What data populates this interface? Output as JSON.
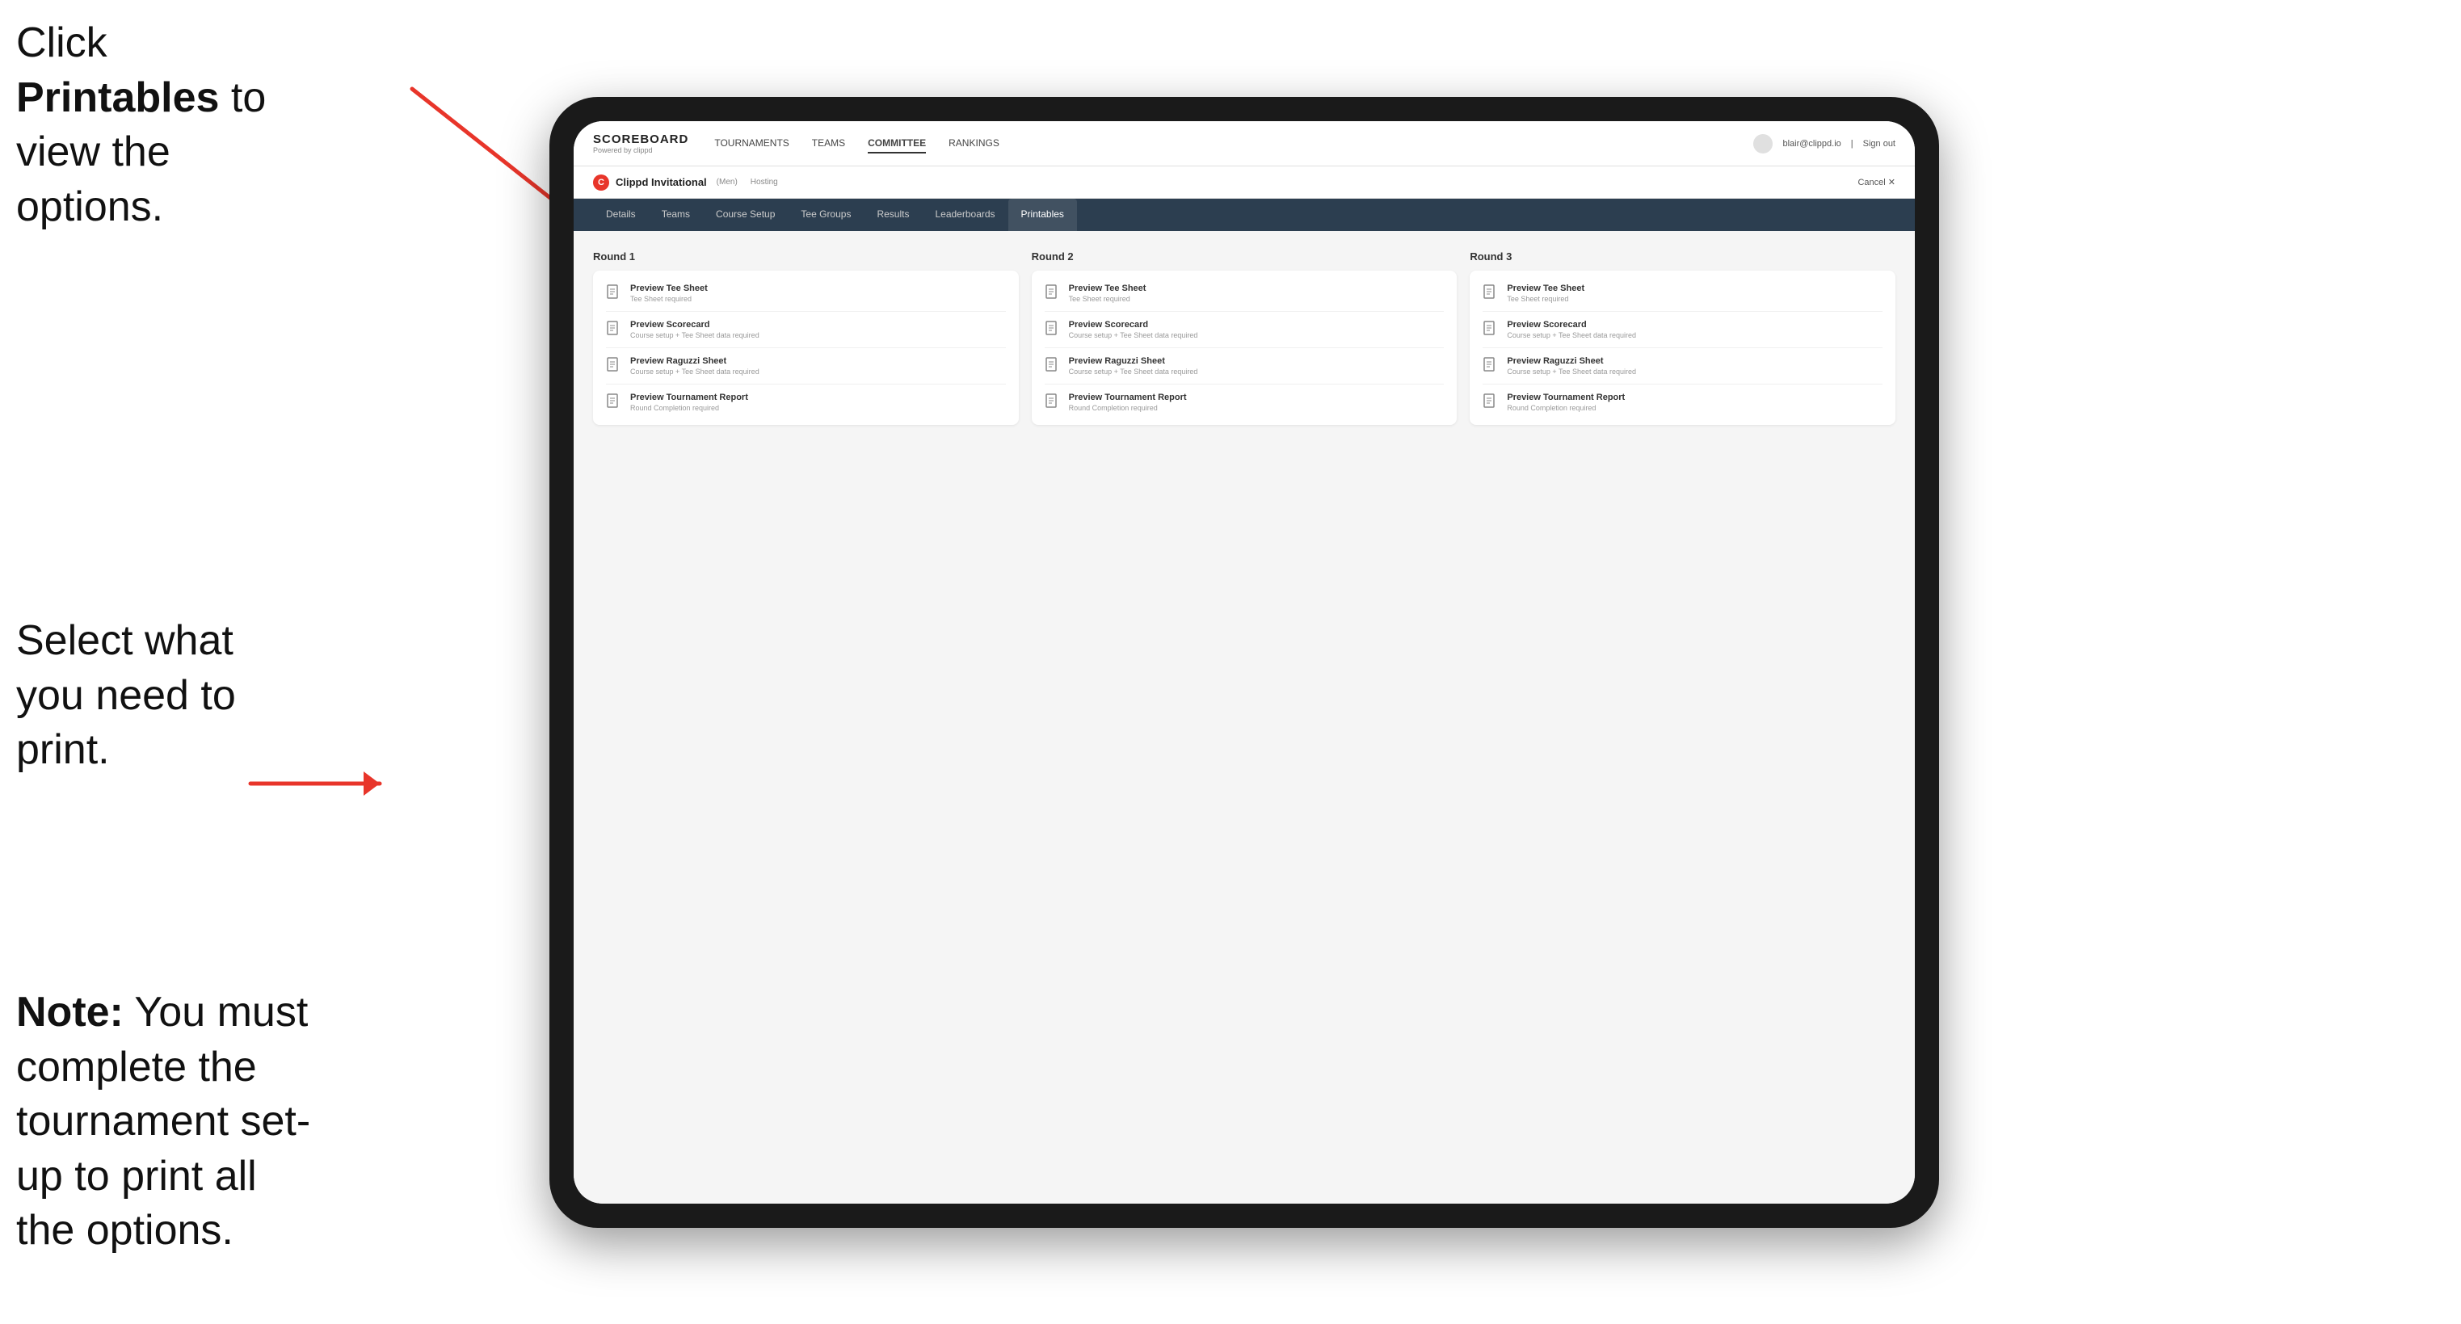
{
  "annotations": {
    "top": {
      "before": "Click ",
      "bold": "Printables",
      "after": " to view the options."
    },
    "middle": {
      "text": "Select what you need to print."
    },
    "bottom": {
      "bold_prefix": "Note:",
      "text": " You must complete the tournament set-up to print all the options."
    }
  },
  "top_nav": {
    "brand": "SCOREBOARD",
    "brand_sub": "Powered by clippd",
    "links": [
      {
        "label": "TOURNAMENTS",
        "active": false
      },
      {
        "label": "TEAMS",
        "active": false
      },
      {
        "label": "COMMITTEE",
        "active": false
      },
      {
        "label": "RANKINGS",
        "active": false
      }
    ],
    "user_email": "blair@clippd.io",
    "sign_out": "Sign out"
  },
  "sub_nav": {
    "tournament_icon": "C",
    "tournament_name": "Clippd Invitational",
    "tournament_bracket": "(Men)",
    "hosting": "Hosting",
    "cancel": "Cancel ✕"
  },
  "tabs": [
    {
      "label": "Details",
      "active": false
    },
    {
      "label": "Teams",
      "active": false
    },
    {
      "label": "Course Setup",
      "active": false
    },
    {
      "label": "Tee Groups",
      "active": false
    },
    {
      "label": "Results",
      "active": false
    },
    {
      "label": "Leaderboards",
      "active": false
    },
    {
      "label": "Printables",
      "active": true
    }
  ],
  "rounds": [
    {
      "title": "Round 1",
      "items": [
        {
          "title": "Preview Tee Sheet",
          "subtitle": "Tee Sheet required"
        },
        {
          "title": "Preview Scorecard",
          "subtitle": "Course setup + Tee Sheet data required"
        },
        {
          "title": "Preview Raguzzi Sheet",
          "subtitle": "Course setup + Tee Sheet data required"
        },
        {
          "title": "Preview Tournament Report",
          "subtitle": "Round Completion required"
        }
      ]
    },
    {
      "title": "Round 2",
      "items": [
        {
          "title": "Preview Tee Sheet",
          "subtitle": "Tee Sheet required"
        },
        {
          "title": "Preview Scorecard",
          "subtitle": "Course setup + Tee Sheet data required"
        },
        {
          "title": "Preview Raguzzi Sheet",
          "subtitle": "Course setup + Tee Sheet data required"
        },
        {
          "title": "Preview Tournament Report",
          "subtitle": "Round Completion required"
        }
      ]
    },
    {
      "title": "Round 3",
      "items": [
        {
          "title": "Preview Tee Sheet",
          "subtitle": "Tee Sheet required"
        },
        {
          "title": "Preview Scorecard",
          "subtitle": "Course setup + Tee Sheet data required"
        },
        {
          "title": "Preview Raguzzi Sheet",
          "subtitle": "Course setup + Tee Sheet data required"
        },
        {
          "title": "Preview Tournament Report",
          "subtitle": "Round Completion required"
        }
      ]
    }
  ]
}
